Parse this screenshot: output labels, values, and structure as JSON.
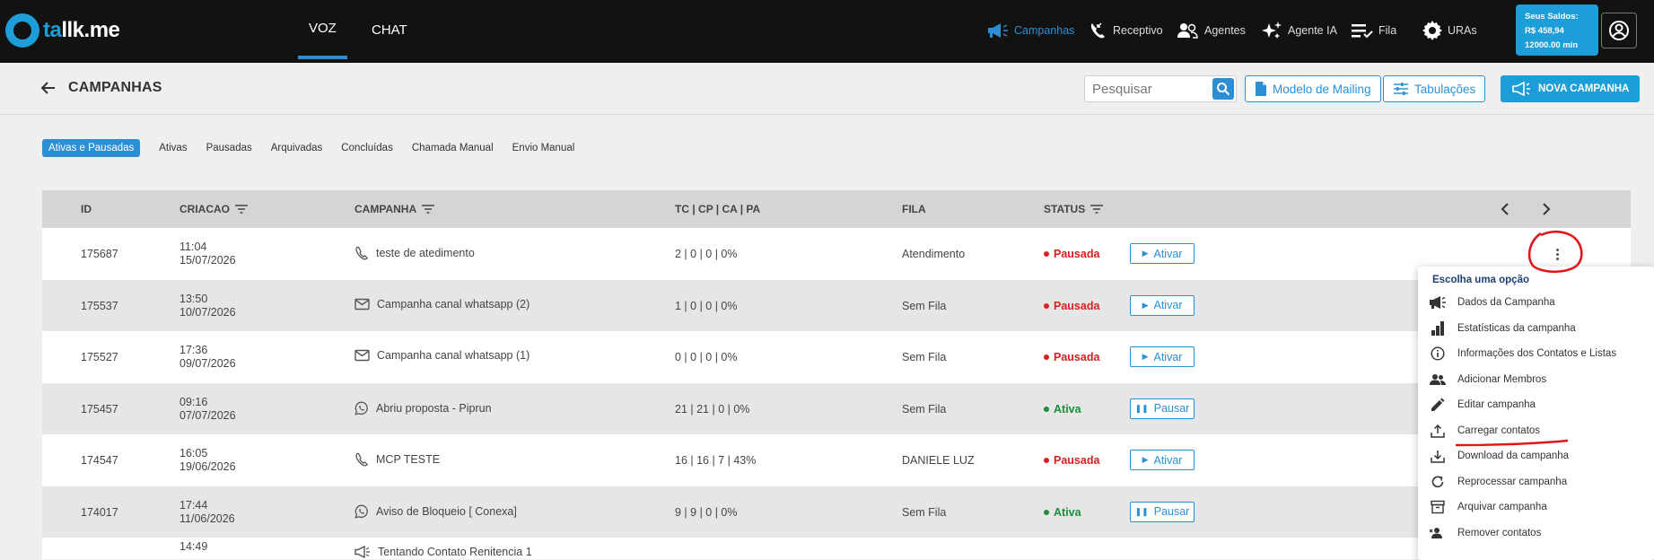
{
  "app": {
    "logo_prefix": "ta",
    "logo_rest": "llk.me"
  },
  "topnav": {
    "tabs": [
      {
        "label": "VOZ",
        "active": true
      },
      {
        "label": "CHAT",
        "active": false
      }
    ],
    "items": [
      {
        "label": "Campanhas",
        "icon": "megaphone-icon",
        "active": true
      },
      {
        "label": "Receptivo",
        "icon": "phone-incoming-icon",
        "active": false
      },
      {
        "label": "Agentes",
        "icon": "users-icon",
        "active": false
      },
      {
        "label": "Agente IA",
        "icon": "sparkle-icon",
        "active": false
      },
      {
        "label": "Fila",
        "icon": "queue-list-icon",
        "active": false
      },
      {
        "label": "URAs",
        "icon": "gear-icon",
        "active": false
      }
    ],
    "saldo": {
      "title": "Seus Saldos:",
      "amount": "R$ 458,94",
      "minutes": "12000.00 min"
    }
  },
  "header": {
    "title": "CAMPANHAS",
    "search_placeholder": "Pesquisar",
    "mailing_label": "Modelo de Mailing",
    "tabulacoes_label": "Tabulações",
    "new_campaign_label": "NOVA CAMPANHA"
  },
  "filters": [
    {
      "label": "Ativas e Pausadas",
      "active": true
    },
    {
      "label": "Ativas",
      "active": false
    },
    {
      "label": "Pausadas",
      "active": false
    },
    {
      "label": "Arquivadas",
      "active": false
    },
    {
      "label": "Concluídas",
      "active": false
    },
    {
      "label": "Chamada Manual",
      "active": false
    },
    {
      "label": "Envio Manual",
      "active": false
    }
  ],
  "table": {
    "headers": {
      "id": "ID",
      "criacao": "CRIACAO",
      "campanha": "CAMPANHA",
      "stats": "TC | CP | CA | PA",
      "fila": "FILA",
      "status": "STATUS"
    },
    "rows": [
      {
        "id": "175687",
        "time": "11:04",
        "date": "15/07/2026",
        "channel": "phone",
        "name": "teste de atedimento",
        "stats": "2 | 0 | 0 | 0%",
        "fila": "Atendimento",
        "status": "Pausada",
        "action": "Ativar"
      },
      {
        "id": "175537",
        "time": "13:50",
        "date": "10/07/2026",
        "channel": "email",
        "name": "Campanha canal whatsapp (2)",
        "stats": "1 | 0 | 0 | 0%",
        "fila": "Sem Fila",
        "status": "Pausada",
        "action": "Ativar"
      },
      {
        "id": "175527",
        "time": "17:36",
        "date": "09/07/2026",
        "channel": "email",
        "name": "Campanha canal whatsapp (1)",
        "stats": "0 | 0 | 0 | 0%",
        "fila": "Sem Fila",
        "status": "Pausada",
        "action": "Ativar"
      },
      {
        "id": "175457",
        "time": "09:16",
        "date": "07/07/2026",
        "channel": "whatsapp",
        "name": "Abriu proposta - Piprun",
        "stats": "21 | 21 | 0 | 0%",
        "fila": "Sem Fila",
        "status": "Ativa",
        "action": "Pausar"
      },
      {
        "id": "174547",
        "time": "16:05",
        "date": "19/06/2026",
        "channel": "phone",
        "name": "MCP TESTE",
        "stats": "16 | 16 | 7 | 43%",
        "fila": "DANIELE LUZ",
        "status": "Pausada",
        "action": "Ativar"
      },
      {
        "id": "174017",
        "time": "17:44",
        "date": "11/06/2026",
        "channel": "whatsapp",
        "name": "Aviso de Bloqueio [ Conexa]",
        "stats": "9 | 9 | 0 | 0%",
        "fila": "Sem Fila",
        "status": "Ativa",
        "action": "Pausar"
      },
      {
        "id": "",
        "time": "14:49",
        "date": "",
        "channel": "megaphone",
        "name": "Tentando Contato Renitencia 1",
        "stats": "",
        "fila": "",
        "status": "",
        "action": ""
      }
    ]
  },
  "menu": {
    "title": "Escolha uma opção",
    "items": [
      {
        "label": "Dados da Campanha",
        "icon": "megaphone-icon"
      },
      {
        "label": "Estatísticas da campanha",
        "icon": "bar-chart-icon"
      },
      {
        "label": "Informações dos Contatos e Listas",
        "icon": "info-icon"
      },
      {
        "label": "Adicionar Membros",
        "icon": "users-icon"
      },
      {
        "label": "Editar campanha",
        "icon": "pencil-icon"
      },
      {
        "label": "Carregar contatos",
        "icon": "upload-icon"
      },
      {
        "label": "Download da campanha",
        "icon": "download-icon"
      },
      {
        "label": "Reprocessar campanha",
        "icon": "refresh-icon"
      },
      {
        "label": "Arquivar campanha",
        "icon": "archive-icon"
      },
      {
        "label": "Remover contatos",
        "icon": "remove-users-icon"
      }
    ]
  },
  "colors": {
    "topbar": "#121212",
    "accent": "#2c8fd6",
    "brand": "#1e9ed9",
    "paused": "#d8201f",
    "active": "#1a8d3a",
    "annotation": "#e0161b"
  }
}
